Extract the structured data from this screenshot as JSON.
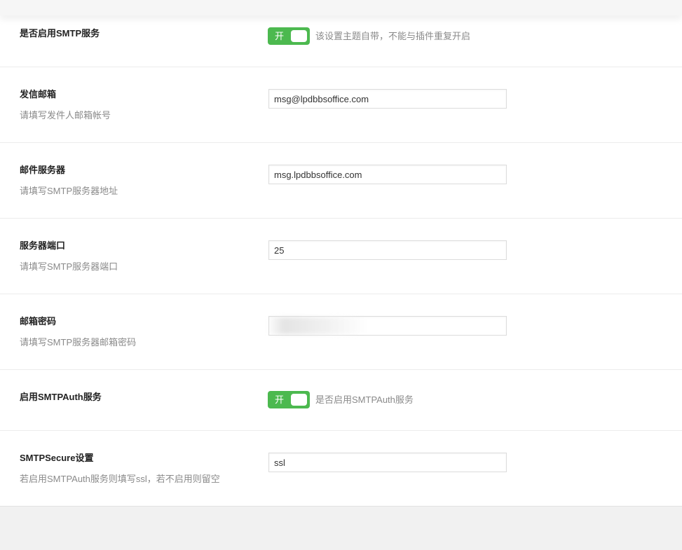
{
  "settings": {
    "smtp_enable": {
      "title": "是否启用SMTP服务",
      "toggle_label": "开",
      "hint": "该设置主题自带，不能与插件重复开启"
    },
    "sender_email": {
      "title": "发信邮箱",
      "desc": "请填写发件人邮箱帐号",
      "value": "msg@lpdbbsoffice.com"
    },
    "mail_server": {
      "title": "邮件服务器",
      "desc": "请填写SMTP服务器地址",
      "value": "msg.lpdbbsoffice.com"
    },
    "server_port": {
      "title": "服务器端口",
      "desc": "请填写SMTP服务器端口",
      "value": "25"
    },
    "mail_password": {
      "title": "邮箱密码",
      "desc": "请填写SMTP服务器邮箱密码",
      "value": ""
    },
    "smtp_auth": {
      "title": "启用SMTPAuth服务",
      "toggle_label": "开",
      "hint": "是否启用SMTPAuth服务"
    },
    "smtp_secure": {
      "title": "SMTPSecure设置",
      "desc": "若启用SMTPAuth服务则填写ssl，若不启用则留空",
      "value": "ssl"
    }
  },
  "colors": {
    "toggle_on": "#4cb94f",
    "panel_bg": "#ffffff",
    "page_bg": "#f1f1f1"
  }
}
